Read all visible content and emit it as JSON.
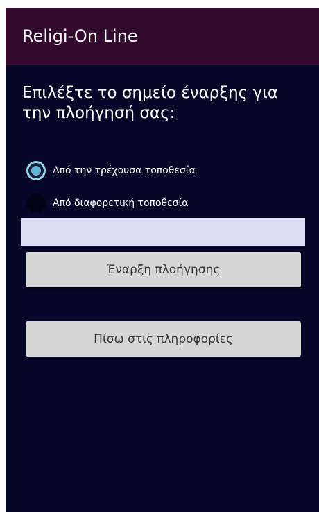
{
  "app": {
    "title": "Religi-On Line"
  },
  "prompt": {
    "text": "Επιλέξτε το σημείο έναρξης για την πλοήγησή σας:"
  },
  "options": [
    {
      "label": "Από την τρέχουσα τοποθεσία",
      "checked": true
    },
    {
      "label": "Από διαφορετική τοποθεσία",
      "checked": false
    }
  ],
  "location_input": {
    "value": "",
    "placeholder": ""
  },
  "buttons": {
    "start_navigation": "Έναρξη πλοήγησης",
    "back_to_info": "Πίσω στις πληροφορίες"
  },
  "colors": {
    "action_bar": "#330a2d",
    "background": "#07072a",
    "radio_accent": "#5bb9d6",
    "input_background": "#dcdcf2",
    "button_background": "#d6d6d6"
  }
}
